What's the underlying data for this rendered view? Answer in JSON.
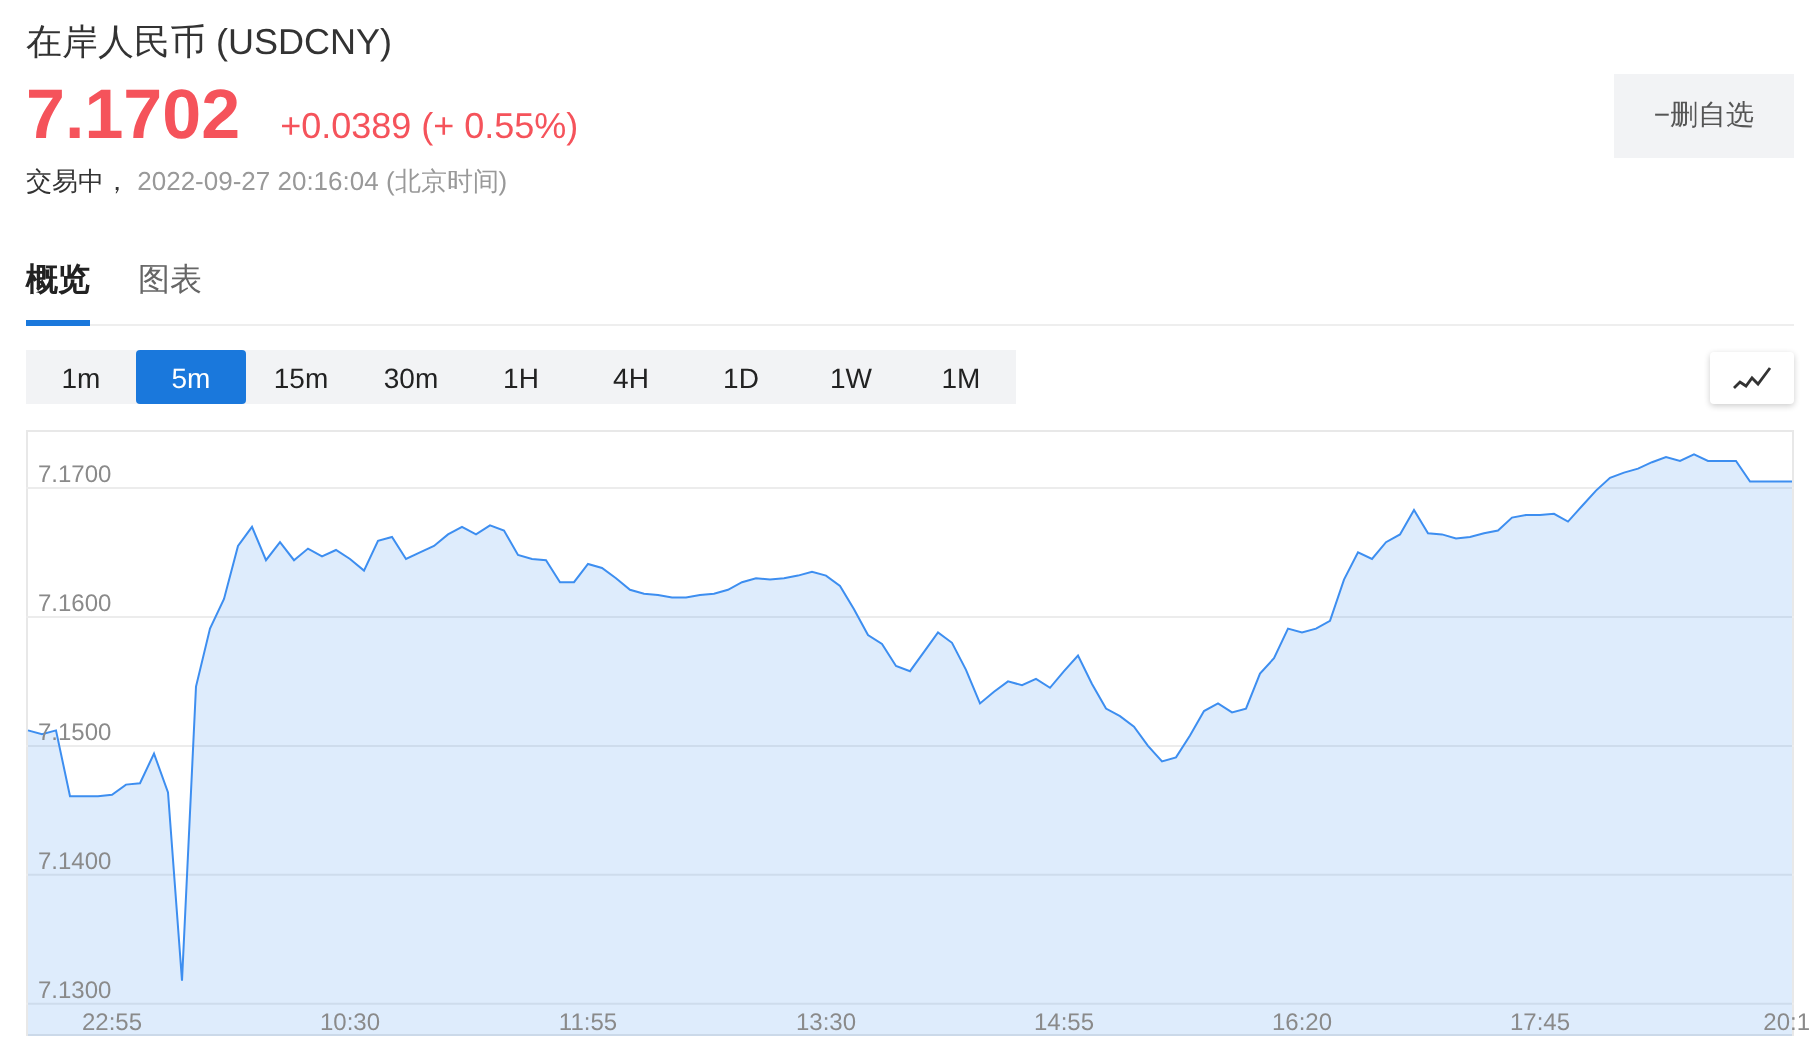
{
  "header": {
    "title": "在岸人民币  (USDCNY)",
    "price": "7.1702",
    "change": "+0.0389 (+ 0.55%)",
    "status": "交易中，",
    "timestamp": "2022-09-27 20:16:04  (北京时间)",
    "watch_button": "−删自选"
  },
  "tabs": [
    {
      "label": "概览",
      "selected": true
    },
    {
      "label": "图表",
      "selected": false
    }
  ],
  "periods": [
    {
      "label": "1m",
      "selected": false
    },
    {
      "label": "5m",
      "selected": true
    },
    {
      "label": "15m",
      "selected": false
    },
    {
      "label": "30m",
      "selected": false
    },
    {
      "label": "1H",
      "selected": false
    },
    {
      "label": "4H",
      "selected": false
    },
    {
      "label": "1D",
      "selected": false
    },
    {
      "label": "1W",
      "selected": false
    },
    {
      "label": "1M",
      "selected": false
    }
  ],
  "chart": {
    "chart_data": {
      "type": "area",
      "grid": true,
      "ylim": [
        7.1275,
        7.1745
      ],
      "categories": [
        null,
        null,
        null,
        null,
        null,
        null,
        "22:55",
        null,
        null,
        null,
        null,
        null,
        null,
        null,
        null,
        null,
        null,
        null,
        null,
        null,
        null,
        null,
        null,
        "10:30",
        null,
        null,
        null,
        null,
        null,
        null,
        null,
        null,
        null,
        null,
        null,
        null,
        null,
        null,
        null,
        null,
        "11:55",
        null,
        null,
        null,
        null,
        null,
        null,
        null,
        null,
        null,
        null,
        null,
        null,
        null,
        null,
        null,
        null,
        "13:30",
        null,
        null,
        null,
        null,
        null,
        null,
        null,
        null,
        null,
        null,
        null,
        null,
        null,
        null,
        null,
        null,
        "14:55",
        null,
        null,
        null,
        null,
        null,
        null,
        null,
        null,
        null,
        null,
        null,
        null,
        null,
        null,
        null,
        null,
        "16:20",
        null,
        null,
        null,
        null,
        null,
        null,
        null,
        null,
        null,
        null,
        null,
        null,
        null,
        null,
        null,
        null,
        "17:45",
        null,
        null,
        null,
        null,
        null,
        null,
        null,
        null,
        null,
        null,
        null,
        null,
        null,
        null,
        null,
        null,
        "20:1",
        null
      ],
      "series": [
        {
          "color": "#3d8ef0",
          "values": [
            7.1512,
            7.1509,
            7.1512,
            7.1461,
            7.1461,
            7.1461,
            7.1462,
            7.147,
            7.1471,
            7.1494,
            7.1464,
            7.1318,
            7.1546,
            7.1591,
            7.1614,
            7.1655,
            7.167,
            7.1644,
            7.1658,
            7.1644,
            7.1653,
            7.1647,
            7.1652,
            7.1645,
            7.1636,
            7.1659,
            7.1662,
            7.1645,
            7.165,
            7.1655,
            7.1664,
            7.167,
            7.1664,
            7.1671,
            7.1667,
            7.1648,
            7.1645,
            7.1644,
            7.1627,
            7.1627,
            7.1641,
            7.1638,
            7.163,
            7.1621,
            7.1618,
            7.1617,
            7.1615,
            7.1615,
            7.1617,
            7.1618,
            7.1621,
            7.1627,
            7.163,
            7.1629,
            7.163,
            7.1632,
            7.1635,
            7.1632,
            7.1624,
            7.1606,
            7.1586,
            7.1579,
            7.1562,
            7.1558,
            7.1573,
            7.1588,
            7.158,
            7.1559,
            7.1533,
            7.1542,
            7.155,
            7.1547,
            7.1552,
            7.1545,
            7.1558,
            7.157,
            7.1548,
            7.1529,
            7.1523,
            7.1515,
            7.15,
            7.1488,
            7.1491,
            7.1508,
            7.1527,
            7.1533,
            7.1526,
            7.1529,
            7.1556,
            7.1568,
            7.1591,
            7.1588,
            7.1591,
            7.1597,
            7.1629,
            7.165,
            7.1645,
            7.1658,
            7.1664,
            7.1683,
            7.1665,
            7.1664,
            7.1661,
            7.1662,
            7.1665,
            7.1667,
            7.1677,
            7.1679,
            7.1679,
            7.168,
            7.1674,
            7.1686,
            7.1698,
            7.1708,
            7.1712,
            7.1715,
            7.172,
            7.1724,
            7.1721,
            7.1726,
            7.1721,
            7.1721,
            7.1721,
            7.1705,
            7.1705,
            7.1705,
            7.1705
          ]
        }
      ],
      "yticks": [
        {
          "value": 7.13,
          "label": "7.1300"
        },
        {
          "value": 7.14,
          "label": "7.1400"
        },
        {
          "value": 7.15,
          "label": "7.1500"
        },
        {
          "value": 7.16,
          "label": "7.1600"
        },
        {
          "value": 7.17,
          "label": "7.1700"
        }
      ]
    }
  }
}
